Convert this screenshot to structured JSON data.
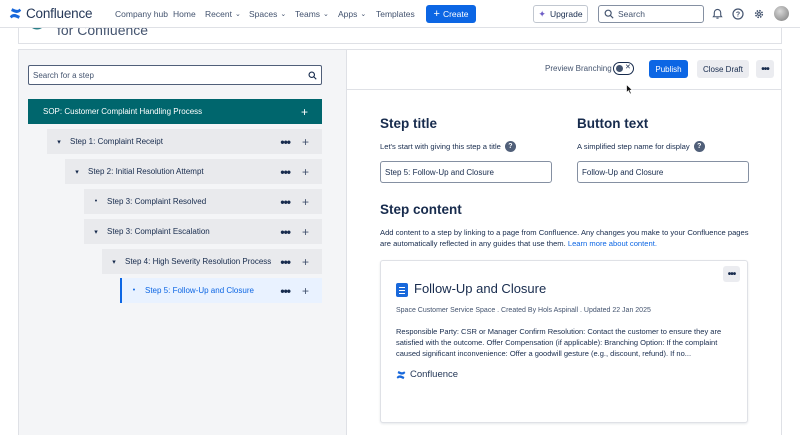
{
  "topnav": {
    "brand": "Confluence",
    "links": [
      {
        "label": "Company hub",
        "dropdown": false
      },
      {
        "label": "Home",
        "dropdown": false
      },
      {
        "label": "Recent",
        "dropdown": true
      },
      {
        "label": "Spaces",
        "dropdown": true
      },
      {
        "label": "Teams",
        "dropdown": true
      },
      {
        "label": "Apps",
        "dropdown": true
      },
      {
        "label": "Templates",
        "dropdown": false
      }
    ],
    "create_label": "Create",
    "upgrade_label": "Upgrade",
    "search_placeholder": "Search"
  },
  "header": {
    "title": "for Confluence"
  },
  "left_pane": {
    "search_placeholder": "Search for a step",
    "root": "SOP: Customer Complaint Handling Process",
    "steps": [
      {
        "label": "Step 1: Complaint Receipt",
        "twisty": "▾",
        "depth": 1,
        "selected": false
      },
      {
        "label": "Step 2: Initial Resolution Attempt",
        "twisty": "▾",
        "depth": 2,
        "selected": false
      },
      {
        "label": "Step 3: Complaint Resolved",
        "twisty": "•",
        "depth": 3,
        "selected": false
      },
      {
        "label": "Step 3: Complaint Escalation",
        "twisty": "▾",
        "depth": 3,
        "selected": false
      },
      {
        "label": "Step 4: High Severity Resolution Process",
        "twisty": "▾",
        "depth": 4,
        "selected": false
      },
      {
        "label": "Step 5: Follow-Up and Closure",
        "twisty": "•",
        "depth": 5,
        "selected": true
      }
    ]
  },
  "toolbar": {
    "preview_branching_label": "Preview Branching",
    "publish_label": "Publish",
    "close_draft_label": "Close Draft"
  },
  "step_title": {
    "heading": "Step title",
    "description": "Let's start with giving this step a title",
    "value": "Step 5: Follow-Up and Closure"
  },
  "button_text": {
    "heading": "Button text",
    "description": "A simplified step name for display",
    "value": "Follow-Up and Closure"
  },
  "step_content": {
    "heading": "Step content",
    "description": "Add content to a step by linking to a page from Confluence. Any changes you make to your Confluence pages are automatically reflected in any guides that use them.",
    "link": "Learn more about content."
  },
  "card": {
    "title": "Follow-Up and Closure",
    "meta": "Space Customer Service Space . Created By Hols Aspinall . Updated 22 Jan 2025",
    "body": "Responsible Party: CSR or Manager Confirm Resolution: Contact the customer to ensure they are satisfied with the outcome. Offer Compensation (if applicable): Branching Option: If the complaint caused significant inconvenience: Offer a goodwill gesture (e.g., discount, refund). If no...",
    "brand": "Confluence"
  },
  "colors": {
    "primary": "#0c66e4",
    "teal": "#00666d",
    "selected_bg": "#e9f2ff"
  }
}
